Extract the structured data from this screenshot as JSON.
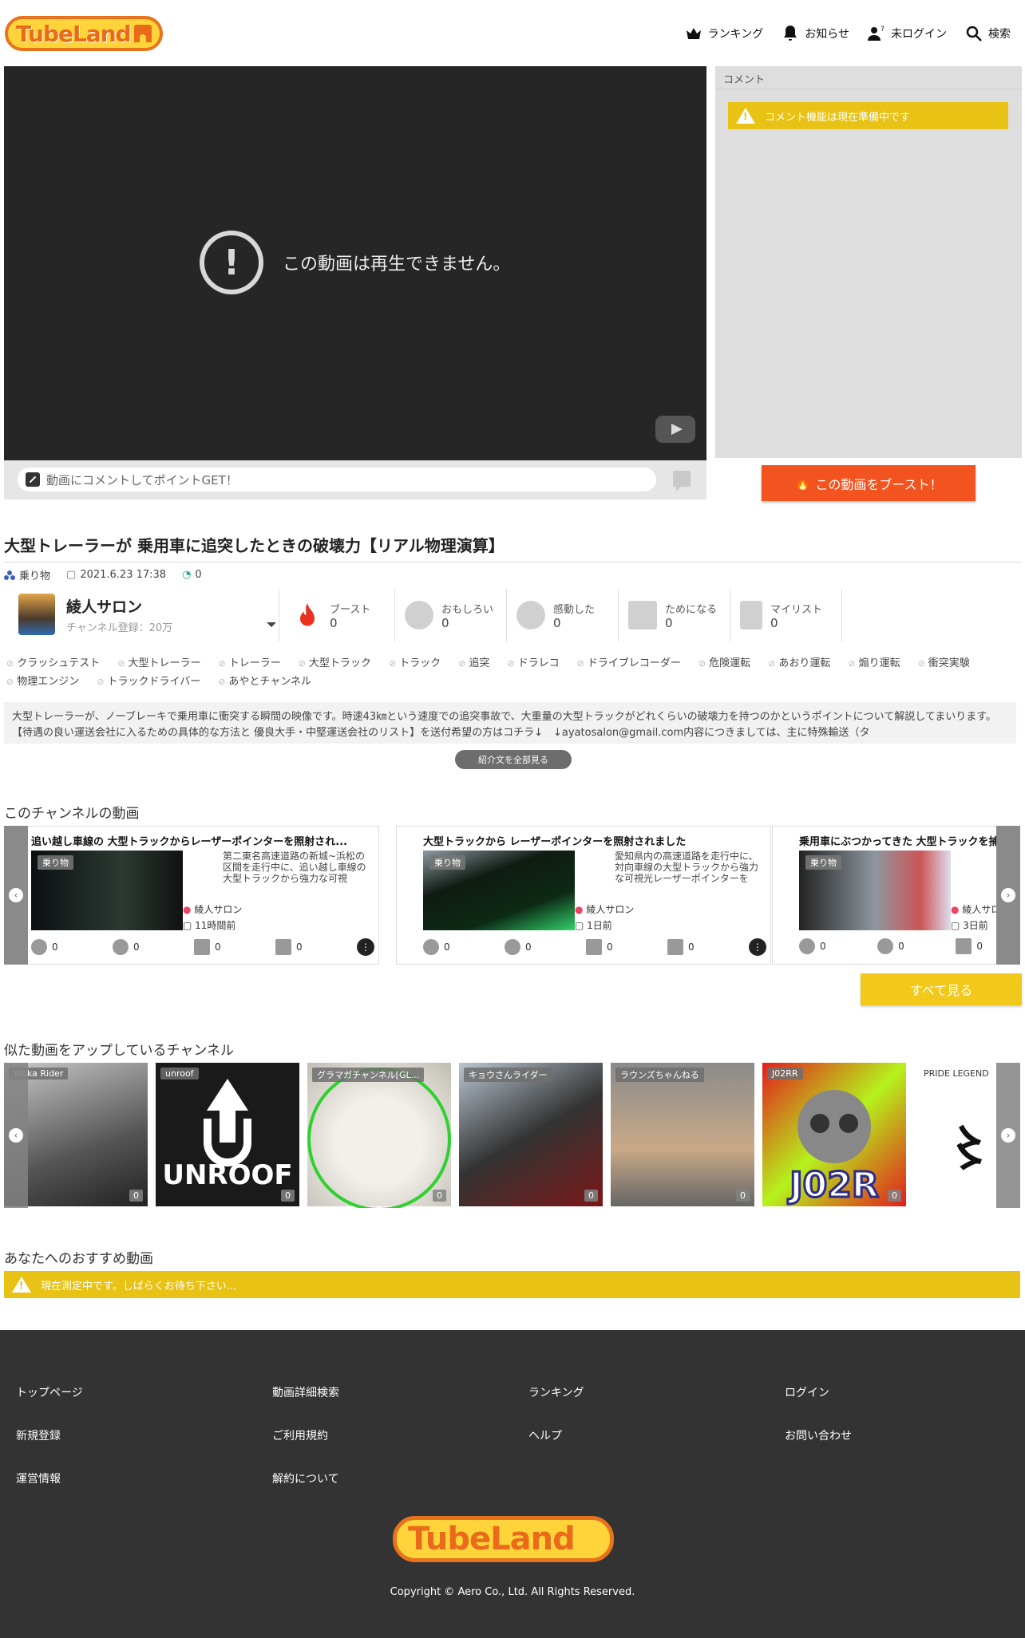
{
  "header": {
    "logo": "TubeLand",
    "nav": [
      "ランキング",
      "お知らせ",
      "未ログイン",
      "検索"
    ]
  },
  "player": {
    "message": "この動画は再生できません。",
    "comment_placeholder": "動画にコメントしてポイントGET！"
  },
  "comments": {
    "header": "コメント",
    "notice": "コメント機能は現在準備中です"
  },
  "boost_button": "この動画をブースト！",
  "video": {
    "title": "大型トレーラーが 乗用車に追突したときの破壊力【リアル物理演算】",
    "category": "乗り物",
    "date": "2021.6.23 17:38",
    "boost_count": "0"
  },
  "channel": {
    "name": "綾人サロン",
    "subscribers": "チャンネル登録：20万"
  },
  "stats": [
    {
      "label": "ブースト",
      "value": "0"
    },
    {
      "label": "おもしろい",
      "value": "0"
    },
    {
      "label": "感動した",
      "value": "0"
    },
    {
      "label": "ためになる",
      "value": "0"
    },
    {
      "label": "マイリスト",
      "value": "0"
    }
  ],
  "tags": [
    "クラッシュテスト",
    "大型トレーラー",
    "トレーラー",
    "大型トラック",
    "トラック",
    "追突",
    "ドラレコ",
    "ドライブレコーダー",
    "危険運転",
    "あおり運転",
    "煽り運転",
    "衝突実験",
    "物理エンジン",
    "トラックドライバー",
    "あやとチャンネル"
  ],
  "description": "大型トレーラーが、ノーブレーキで乗用車に衝突する瞬間の映像です。時速43㎞という速度での追突事故で、大重量の大型トラックがどれくらいの破壊力を持つのかというポイントについて解説してまいります。【待遇の良い運送会社に入るための具体的な方法と 優良大手・中堅運送会社のリスト】を送付希望の方はコチラ↓　↓ayatosalon@gmail.com内容につきましては、主に特殊輸送（タ",
  "more_button": "紹介文を全部見る",
  "channel_videos": {
    "title": "このチャンネルの動画",
    "see_all": "すべて見る",
    "items": [
      {
        "title": "追い越し車線の 大型トラックからレーザーポインターを照射され...",
        "badge": "乗り物",
        "desc": "第二東名高速道路の新城~浜松の区間を走行中に、追い越し車線の大型トラックから強力な可視",
        "author": "綾人サロン",
        "time": "11時間前",
        "counts": [
          "0",
          "0",
          "0",
          "0"
        ]
      },
      {
        "title": "大型トラックから レーザーポインターを照射されました",
        "badge": "乗り物",
        "desc": "愛知県内の高速道路を走行中に、対向車線の大型トラックから強力な可視光レーザーポインターを",
        "author": "綾人サロン",
        "time": "1日前",
        "counts": [
          "0",
          "0",
          "0",
          "0"
        ]
      },
      {
        "title": "乗用車にぶつかってきた 大型トラックを捕ま",
        "badge": "乗り物",
        "desc": "",
        "author": "綾人サロン",
        "time": "3日前",
        "counts": [
          "0",
          "0",
          "0"
        ]
      }
    ]
  },
  "similar_channels": {
    "title": "似た動画をアップしているチャンネル",
    "items": [
      {
        "name": "Woka Rider",
        "count": "0"
      },
      {
        "name": "unroof",
        "count": "0"
      },
      {
        "name": "グラマガチャンネル[GL...",
        "count": "0"
      },
      {
        "name": "キョウさんライダー",
        "count": "0"
      },
      {
        "name": "ラウンズちゃんねる",
        "count": "0"
      },
      {
        "name": "J02RR",
        "count": "0"
      },
      {
        "name": "PRIDE LEGEND",
        "count": ""
      }
    ]
  },
  "recommend": {
    "title": "あなたへのおすすめ動画",
    "notice": "現在測定中です。しばらくお待ち下さい..."
  },
  "footer": {
    "links": [
      "トップページ",
      "動画詳細検索",
      "ランキング",
      "ログイン",
      "新規登録",
      "ご利用規約",
      "ヘルプ",
      "お問い合わせ",
      "運営情報",
      "解約について"
    ],
    "logo": "TubeLand",
    "copyright": "Copyright © Aero Co., Ltd. All Rights Reserved."
  },
  "colors": {
    "accent_orange": "#f2531f",
    "accent_yellow": "#e8c214",
    "footer_bg": "#333333"
  }
}
